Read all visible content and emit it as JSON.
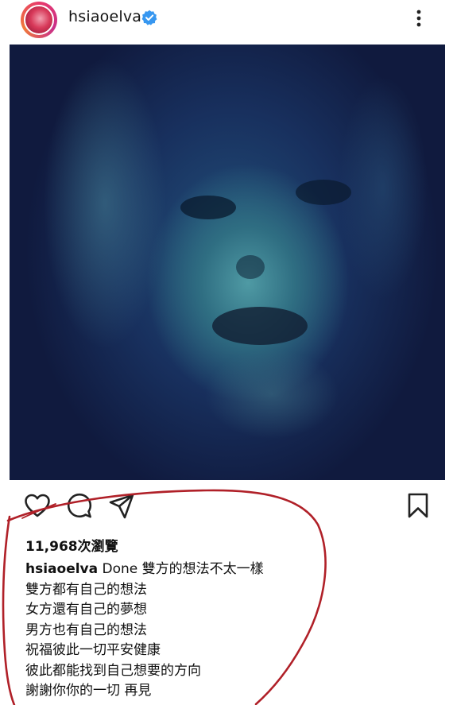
{
  "post": {
    "username": "hsiaoelva",
    "verified": true,
    "views_text": "11,968次瀏覽",
    "caption_first": "Done 雙方的想法不太一樣",
    "caption_lines": [
      "雙方都有自己的想法",
      "女方還有自己的夢想",
      "男方也有自己的想法",
      "祝福彼此一切平安健康",
      "彼此都能找到自己想要的方向",
      "謝謝你你的一切  再見"
    ]
  },
  "icons": {
    "verified": "verified-badge-icon",
    "more": "more-vertical-icon",
    "like": "heart-icon",
    "comment": "comment-bubble-icon",
    "share": "paper-plane-icon",
    "save": "bookmark-icon"
  },
  "colors": {
    "verified_blue": "#3797f0",
    "annotation_red": "#b02028",
    "photo_tint": "#2f6e82"
  }
}
